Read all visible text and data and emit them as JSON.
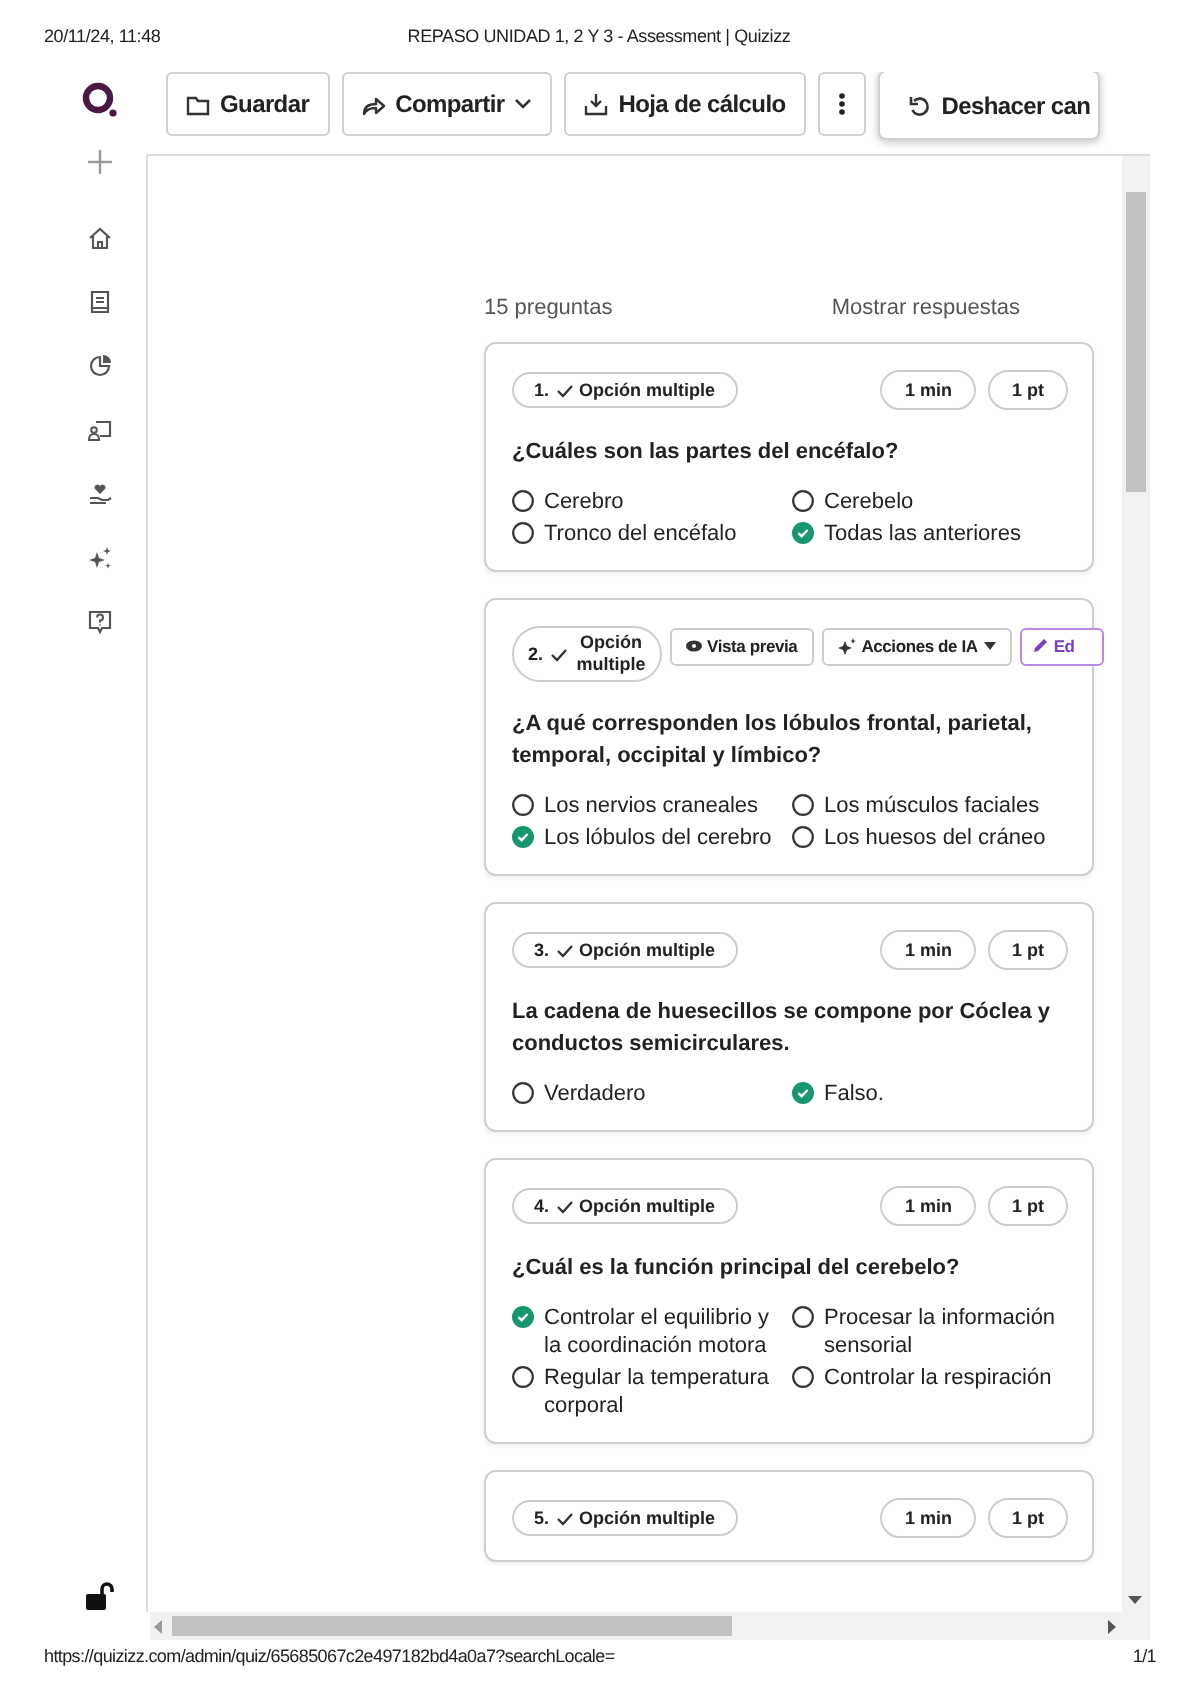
{
  "print_header": {
    "date": "20/11/24, 11:48",
    "title": "REPASO UNIDAD 1, 2 Y 3 - Assessment | Quizizz"
  },
  "toolbar": {
    "buttons": [
      {
        "kind": "save",
        "label": "Guardar"
      },
      {
        "kind": "share",
        "label": "Compartir",
        "dropdown": true
      },
      {
        "kind": "export",
        "label": "Hoja de cálculo"
      },
      {
        "kind": "more"
      },
      {
        "kind": "undo",
        "label": "Deshacer can"
      }
    ]
  },
  "summary": {
    "count": "15 preguntas",
    "toggle": "Mostrar respuestas"
  },
  "questions": [
    {
      "number": "1.",
      "type": "Opción multiple",
      "time": "1 min",
      "points": "1 pt",
      "text": "¿Cuáles son las partes del encéfalo?",
      "options": [
        {
          "text": "Cerebro",
          "correct": false
        },
        {
          "text": "Cerebelo",
          "correct": false
        },
        {
          "text": "Tronco del encéfalo",
          "correct": false
        },
        {
          "text": "Todas las anteriores",
          "correct": true
        }
      ]
    },
    {
      "number": "2.",
      "type": "Opción multiple",
      "actions": [
        {
          "kind": "preview",
          "label": "Vista previa"
        },
        {
          "kind": "ai",
          "label": "Acciones de IA",
          "dropdown": true
        },
        {
          "kind": "edit",
          "label": "Ed"
        }
      ],
      "text": "¿A qué corresponden los lóbulos frontal, parietal, temporal, occipital y límbico?",
      "options": [
        {
          "text": "Los nervios craneales",
          "correct": false
        },
        {
          "text": "Los músculos faciales",
          "correct": false
        },
        {
          "text": "Los lóbulos del cerebro",
          "correct": true
        },
        {
          "text": "Los huesos del cráneo",
          "correct": false
        }
      ]
    },
    {
      "number": "3.",
      "type": "Opción multiple",
      "time": "1 min",
      "points": "1 pt",
      "text": "La cadena de huesecillos se compone por Cóclea y conductos semicirculares.",
      "options": [
        {
          "text": "Verdadero",
          "correct": false
        },
        {
          "text": "Falso.",
          "correct": true
        }
      ]
    },
    {
      "number": "4.",
      "type": "Opción multiple",
      "time": "1 min",
      "points": "1 pt",
      "text": "¿Cuál es la función principal del cerebelo?",
      "options": [
        {
          "text": "Controlar el equilibrio y la coordinación motora",
          "correct": true
        },
        {
          "text": "Procesar la información sensorial",
          "correct": false
        },
        {
          "text": "Regular la temperatura corporal",
          "correct": false
        },
        {
          "text": "Controlar la respiración",
          "correct": false
        }
      ]
    },
    {
      "number": "5.",
      "type": "Opción multiple",
      "time": "1 min",
      "points": "1 pt"
    }
  ],
  "print_footer": {
    "url": "https://quizizz.com/admin/quiz/65685067c2e497182bd4a0a7?searchLocale=",
    "page": "1/1"
  }
}
